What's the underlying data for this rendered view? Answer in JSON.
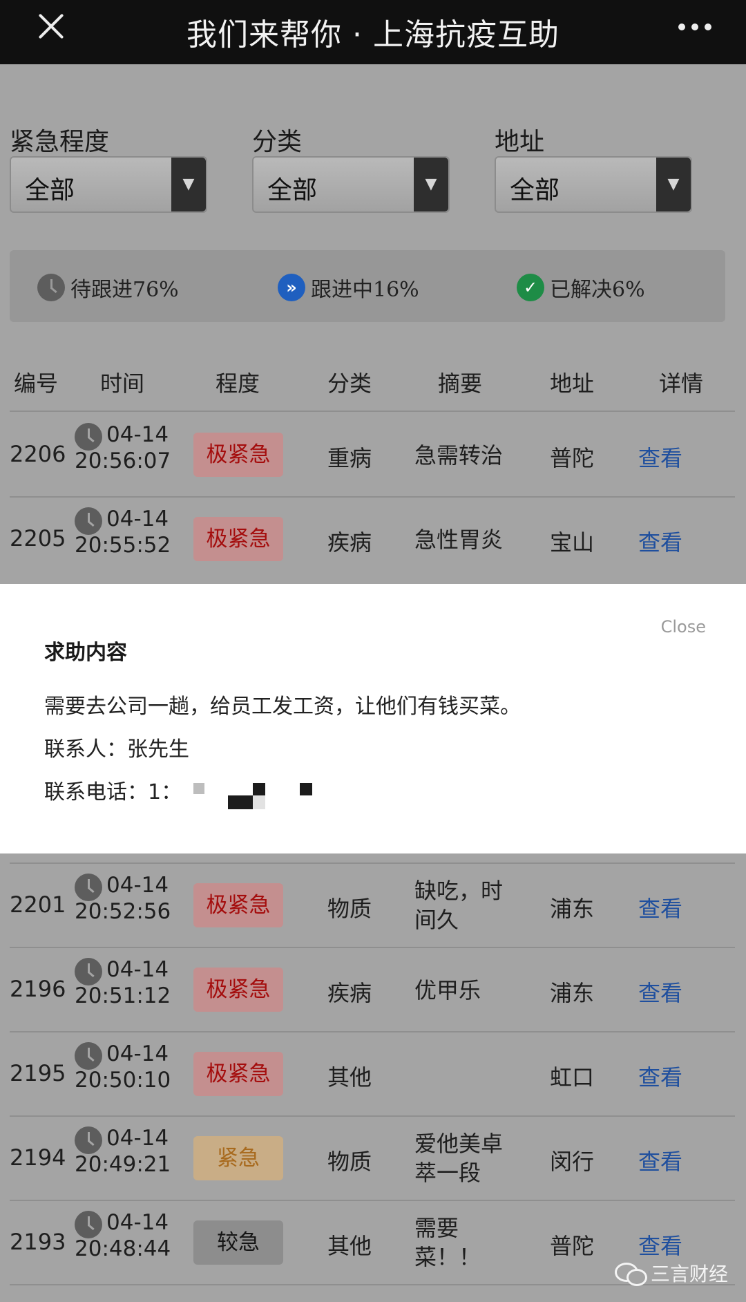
{
  "topbar": {
    "title": "我们来帮你 · 上海抗疫互助"
  },
  "filters": [
    {
      "label": "紧急程度",
      "value": "全部"
    },
    {
      "label": "分类",
      "value": "全部"
    },
    {
      "label": "地址",
      "value": "全部"
    }
  ],
  "status": [
    {
      "icon": "clock-icon",
      "text": "待跟进76%"
    },
    {
      "icon": "forward-icon",
      "text": "跟进中16%"
    },
    {
      "icon": "check-icon",
      "text": "已解决6%"
    }
  ],
  "table": {
    "headers": [
      "编号",
      "时间",
      "程度",
      "分类",
      "摘要",
      "地址",
      "详情"
    ],
    "rows": [
      {
        "id": "2206",
        "date": "04-14",
        "time": "20:56:07",
        "level": "极紧急",
        "category": "重病",
        "summary": "急需转治",
        "address": "普陀",
        "link": "查看"
      },
      {
        "id": "2205",
        "date": "04-14",
        "time": "20:55:52",
        "level": "极紧急",
        "category": "疾病",
        "summary": "急性胃炎",
        "address": "宝山",
        "link": "查看"
      },
      {
        "id": "2201",
        "date": "04-14",
        "time": "20:52:56",
        "level": "极紧急",
        "category": "物质",
        "summary": "缺吃，时间久",
        "address": "浦东",
        "link": "查看"
      },
      {
        "id": "2196",
        "date": "04-14",
        "time": "20:51:12",
        "level": "极紧急",
        "category": "疾病",
        "summary": "优甲乐",
        "address": "浦东",
        "link": "查看"
      },
      {
        "id": "2195",
        "date": "04-14",
        "time": "20:50:10",
        "level": "极紧急",
        "category": "其他",
        "summary": "",
        "address": "虹口",
        "link": "查看"
      },
      {
        "id": "2194",
        "date": "04-14",
        "time": "20:49:21",
        "level": "紧急",
        "category": "物质",
        "summary": "爱他美卓萃一段",
        "address": "闵行",
        "link": "查看"
      },
      {
        "id": "2193",
        "date": "04-14",
        "time": "20:48:44",
        "level": "较急",
        "category": "其他",
        "summary": "需要菜！！",
        "address": "普陀",
        "link": "查看"
      }
    ]
  },
  "modal": {
    "close_label": "Close",
    "title": "求助内容",
    "content": "需要去公司一趟，给员工发工资，让他们有钱买菜。",
    "contact": "联系人：张先生",
    "phone": "联系电话：1："
  },
  "watermark": {
    "text": "三言财经"
  },
  "colors": {
    "level_extreme": "#a40d0d",
    "level_urgent": "#a86a1e",
    "level_moderate": "#151515",
    "link": "#1f4f9e",
    "topbar": "#101010"
  }
}
